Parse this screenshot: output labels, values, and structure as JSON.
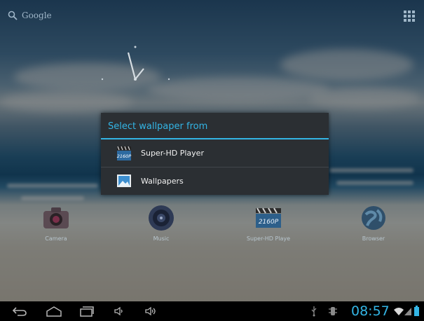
{
  "search": {
    "label": "Google",
    "icon": "search-icon"
  },
  "dialog": {
    "title": "Select wallpaper from",
    "options": [
      {
        "label": "Super-HD Player",
        "icon": "super-hd-player-icon",
        "badge": "2160P"
      },
      {
        "label": "Wallpapers",
        "icon": "wallpapers-icon"
      }
    ]
  },
  "dock": [
    {
      "label": "Camera",
      "icon": "camera-icon"
    },
    {
      "label": "Music",
      "icon": "music-icon"
    },
    {
      "label": "Super-HD Playe",
      "icon": "super-hd-player-icon",
      "badge": "2160P"
    },
    {
      "label": "Browser",
      "icon": "browser-icon"
    }
  ],
  "navbar": {
    "buttons": [
      "back-icon",
      "home-icon",
      "recent-apps-icon",
      "volume-down-icon",
      "volume-up-icon"
    ],
    "status_icons": [
      "usb-icon",
      "debug-icon",
      "wifi-icon",
      "signal-icon",
      "battery-icon"
    ],
    "time": "08:57"
  },
  "colors": {
    "accent": "#33b5e5",
    "dialog_bg": "#2b2f33"
  }
}
